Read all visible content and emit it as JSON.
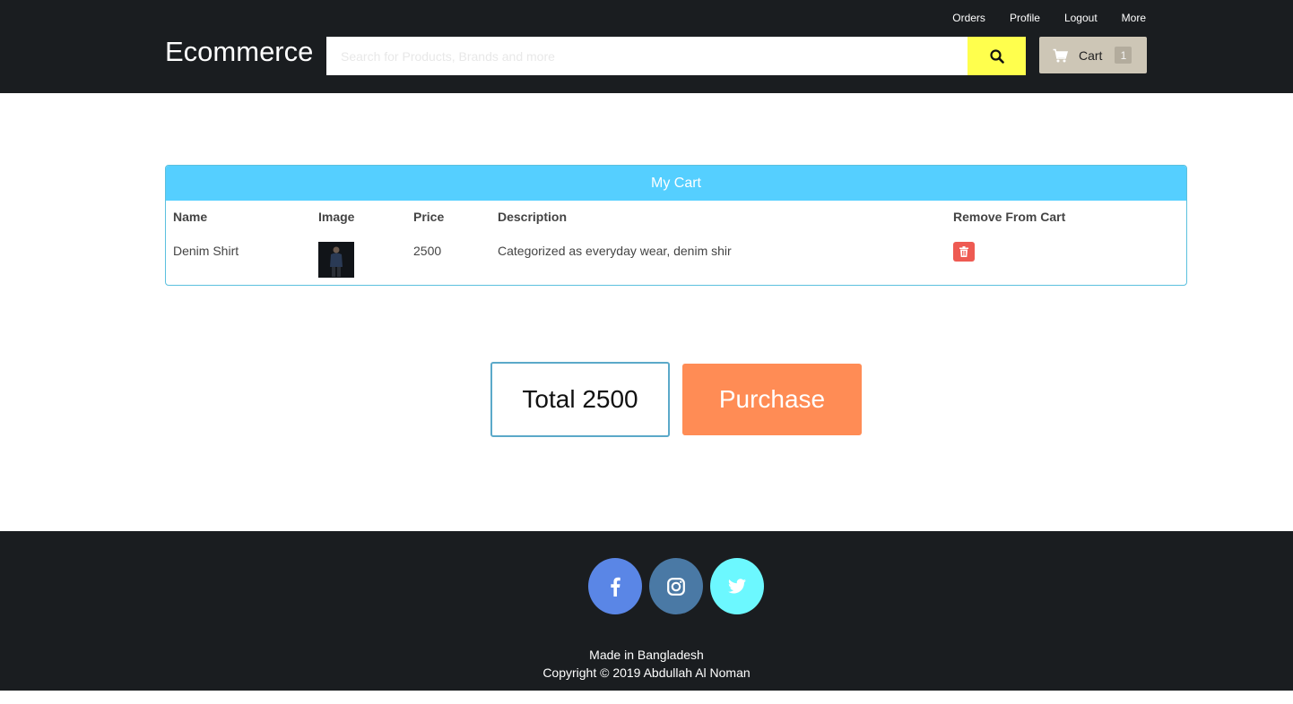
{
  "header": {
    "brand": "Ecommerce",
    "nav": [
      "Orders",
      "Profile",
      "Logout",
      "More"
    ],
    "search_placeholder": "Search for Products, Brands and more",
    "cart_label": "Cart",
    "cart_count": "1"
  },
  "cart": {
    "title": "My Cart",
    "columns": [
      "Name",
      "Image",
      "Price",
      "Description",
      "Remove From Cart"
    ],
    "rows": [
      {
        "name": "Denim Shirt",
        "price": "2500",
        "description": "Categorized as everyday wear, denim shir"
      }
    ]
  },
  "summary": {
    "total_label": "Total 2500",
    "purchase_label": "Purchase"
  },
  "footer": {
    "made_in": "Made in Bangladesh",
    "copyright": "Copyright © 2019 Abdullah Al Noman"
  },
  "colors": {
    "header_bg": "#1a1d20",
    "search_button": "#ffff4d",
    "cart_button": "#cdc6b6",
    "panel_head": "#55cfff",
    "delete_button": "#ee5a52",
    "purchase_button": "#ff8c55",
    "facebook": "#5a86e6",
    "instagram": "#4a79a5",
    "twitter": "#6cf8ff"
  },
  "icons": [
    "search-icon",
    "cart-icon",
    "trash-icon",
    "facebook-icon",
    "instagram-icon",
    "twitter-icon"
  ]
}
